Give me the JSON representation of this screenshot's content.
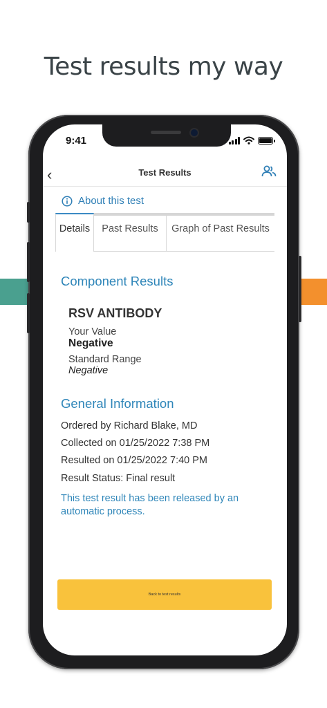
{
  "headline": "Test results my way",
  "colors": {
    "band_left": "#4aa08f",
    "band_right": "#f3902d",
    "accent": "#2f86b9",
    "button": "#f9c23c"
  },
  "status_bar": {
    "time": "9:41",
    "icons": [
      "signal-icon",
      "wifi-icon",
      "battery-icon"
    ]
  },
  "nav": {
    "back_icon": "chevron-left-icon",
    "title": "Test Results",
    "people_icon": "people-icon"
  },
  "about": {
    "icon": "info-icon",
    "label": "About this test"
  },
  "tabs": [
    {
      "label": "Details",
      "active": true
    },
    {
      "label": "Past Results",
      "active": false
    },
    {
      "label": "Graph of Past Results",
      "active": false
    }
  ],
  "component": {
    "heading": "Component Results",
    "name": "RSV ANTIBODY",
    "your_value_label": "Your Value",
    "your_value": "Negative",
    "standard_range_label": "Standard Range",
    "standard_range": "Negative"
  },
  "general": {
    "heading": "General Information",
    "ordered_by": "Ordered by Richard Blake, MD",
    "collected": "Collected on 01/25/2022 7:38 PM",
    "resulted": "Resulted on 01/25/2022 7:40 PM",
    "status": "Result Status: Final result",
    "release_note": "This test result has been released by an automatic process."
  },
  "back_button": {
    "label": "Back to test results"
  }
}
